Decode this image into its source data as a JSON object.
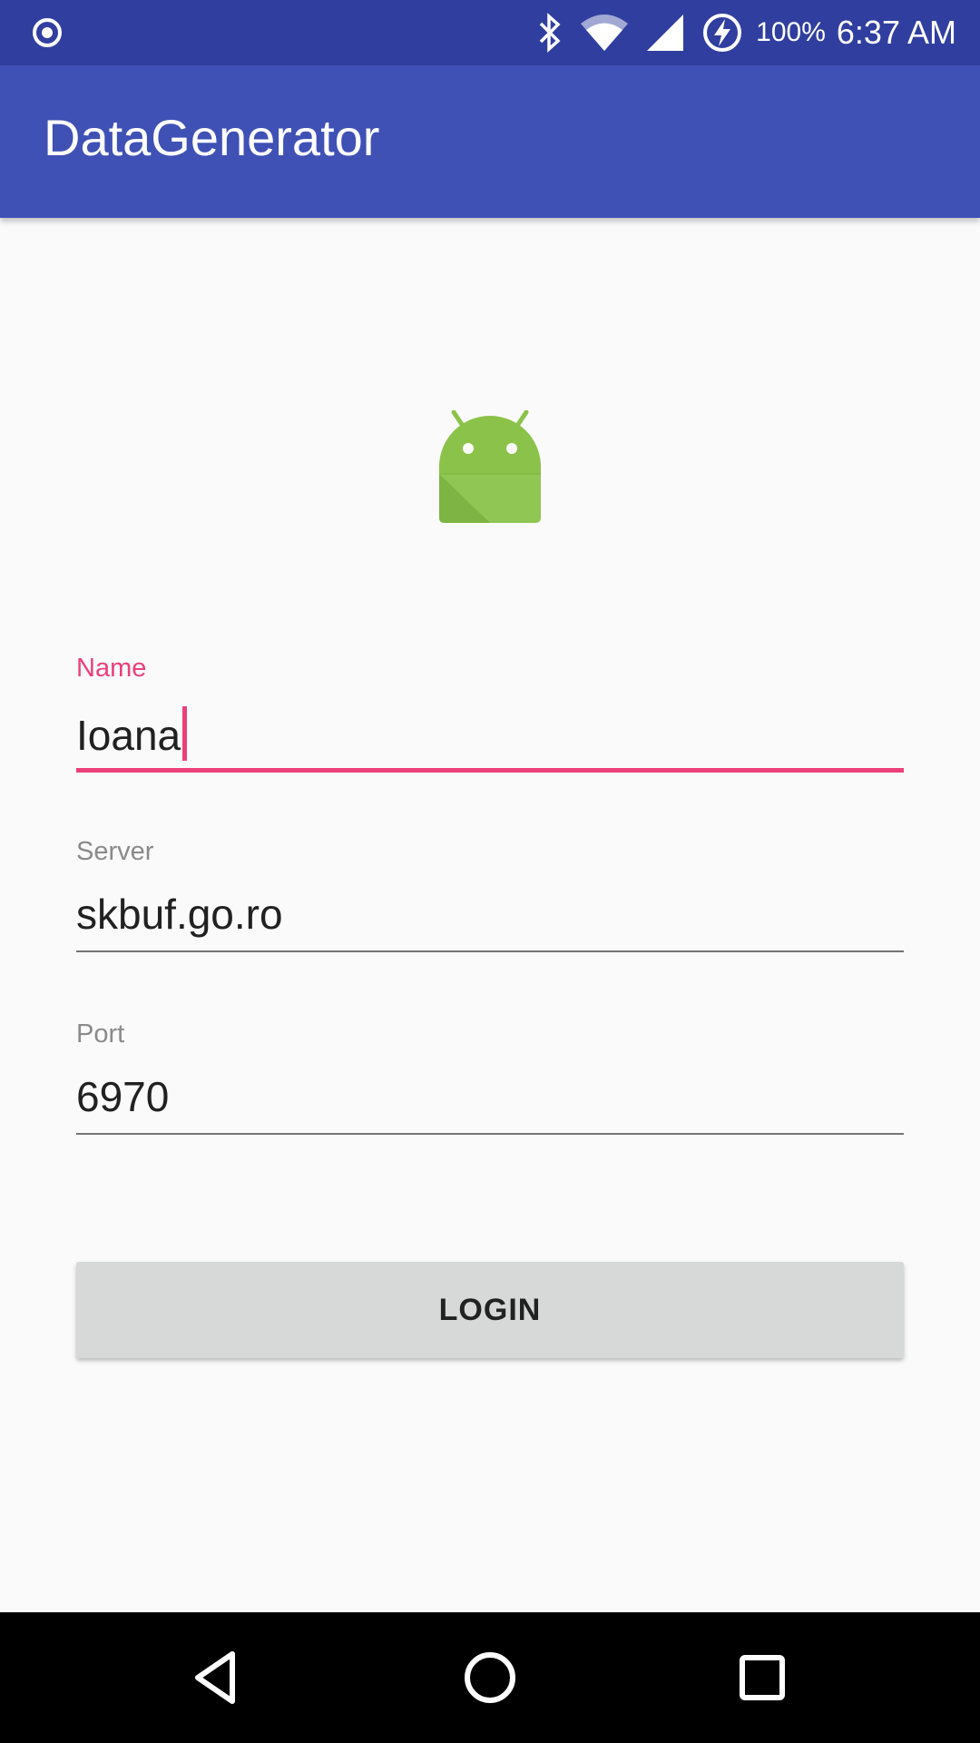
{
  "status_bar": {
    "battery": "100%",
    "time": "6:37 AM",
    "icons": [
      "record-icon",
      "bluetooth-icon",
      "wifi-icon",
      "signal-icon",
      "battery-charging-icon"
    ]
  },
  "app_bar": {
    "title": "DataGenerator"
  },
  "logo": {
    "icon": "android-icon"
  },
  "form": {
    "name": {
      "label": "Name",
      "value": "Ioana"
    },
    "server": {
      "label": "Server",
      "value": "skbuf.go.ro"
    },
    "port": {
      "label": "Port",
      "value": "6970"
    },
    "login_label": "LOGIN"
  },
  "nav_bar": {
    "icons": [
      "back-icon",
      "home-icon",
      "recents-icon"
    ]
  },
  "colors": {
    "status_bar": "#303f9f",
    "app_bar": "#3f51b5",
    "accent": "#ec407a",
    "android_green": "#8bc34a"
  }
}
